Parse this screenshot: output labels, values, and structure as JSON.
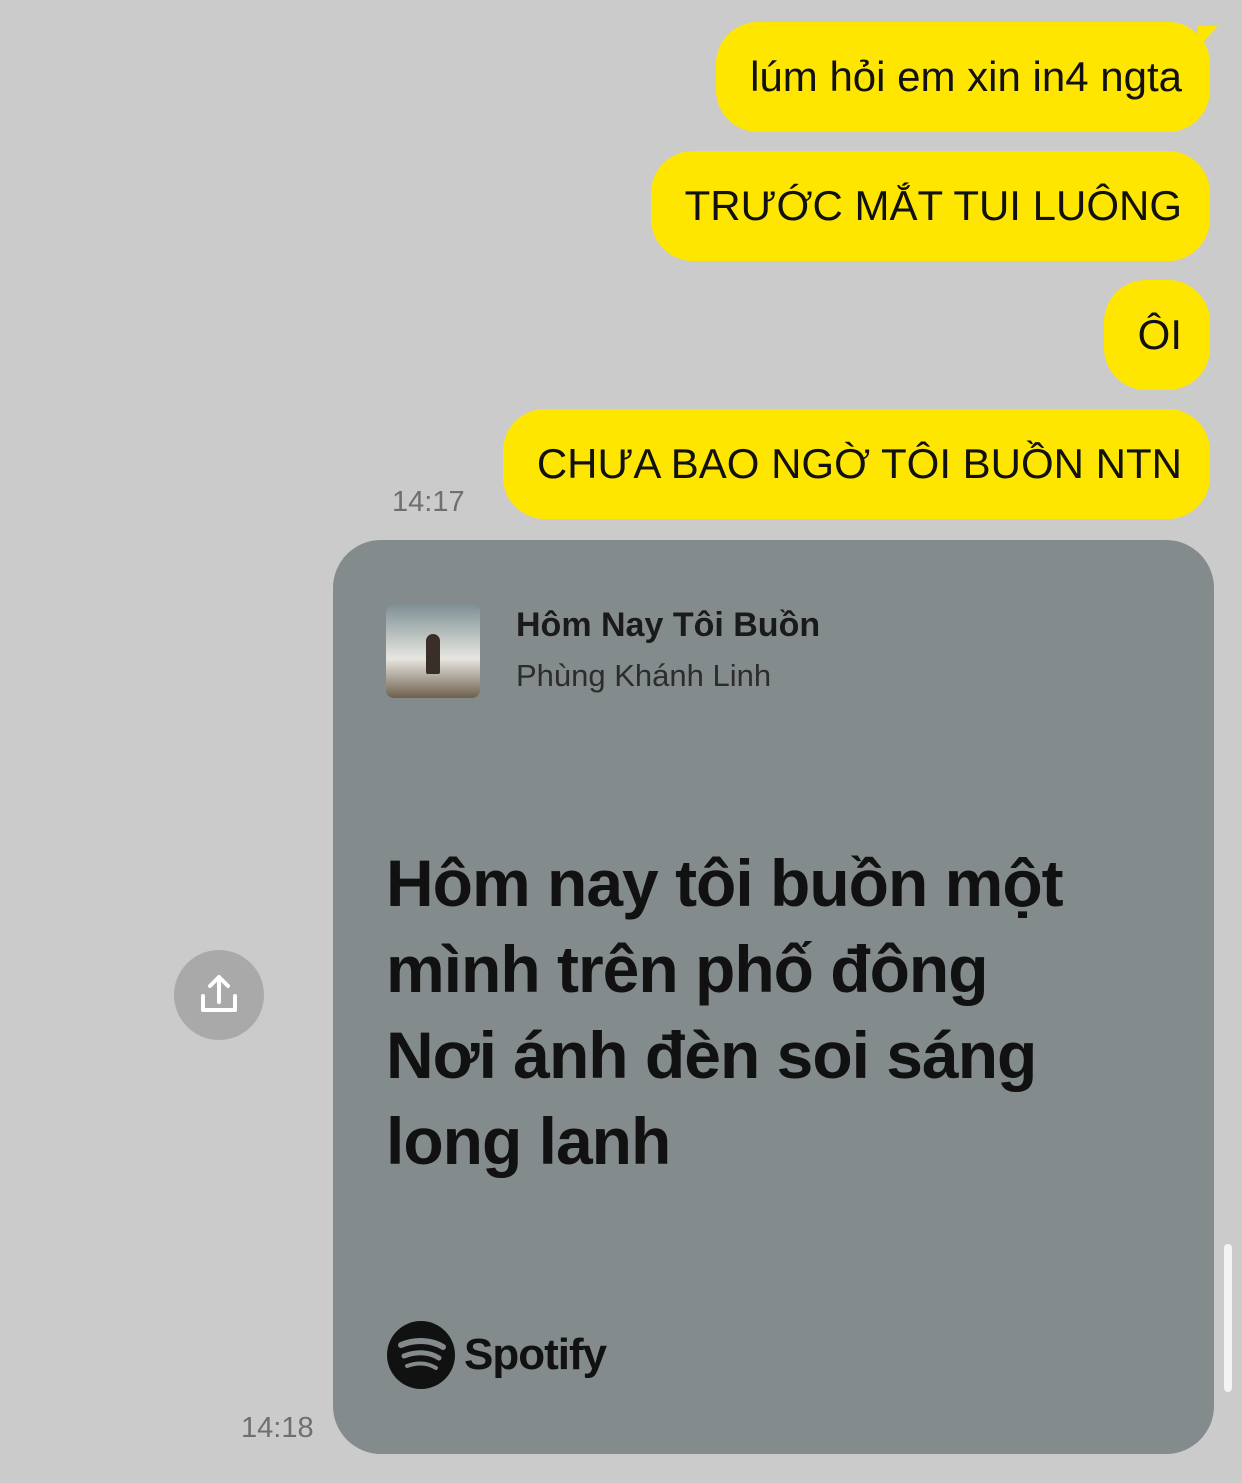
{
  "messages": [
    {
      "text": "lúm hỏi em xin in4 ngta"
    },
    {
      "text": "TRƯỚC MẮT TUI LUÔNG"
    },
    {
      "text": "ÔI"
    },
    {
      "text": "CHƯA BAO NGỜ TÔI BUỒN NTN"
    }
  ],
  "timestamps": {
    "first_group": "14:17",
    "shared_card": "14:18"
  },
  "shared_card": {
    "song_title": "Hôm Nay Tôi Buồn",
    "artist": "Phùng Khánh Linh",
    "lyrics": [
      "Hôm nay tôi buồn một",
      "mình trên phố đông",
      "Nơi ánh đèn soi sáng",
      "long lanh"
    ],
    "brand": "Spotify",
    "background_color": "#848b8c"
  },
  "colors": {
    "background": "#cbcbcb",
    "outgoing_bubble": "#ffe600"
  },
  "icons": {
    "share": "share-upload-icon",
    "album": "album-art-image",
    "brand": "spotify-logo-icon"
  }
}
